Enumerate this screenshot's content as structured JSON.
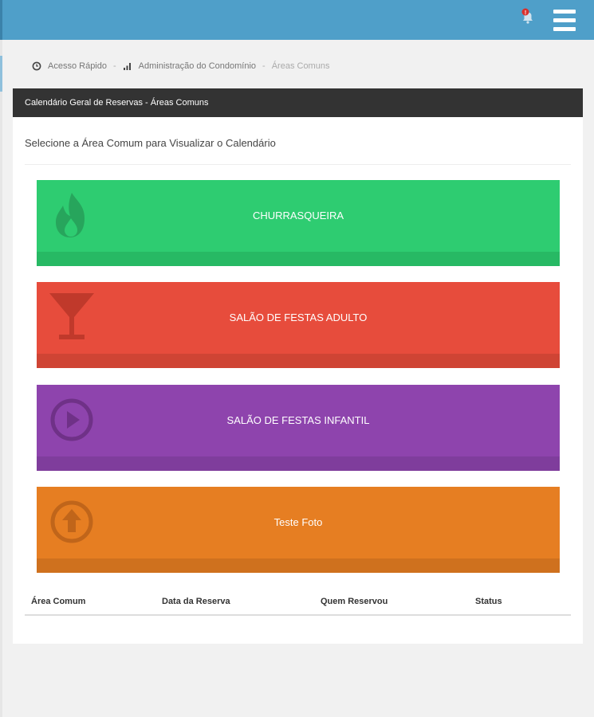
{
  "header": {
    "notification_badge": "!",
    "colors": {
      "bar": "#4f9fc9"
    },
    "icons": [
      "bell-icon",
      "hamburger-menu-icon"
    ]
  },
  "breadcrumb": {
    "items": [
      "Acesso Rápido",
      "Administração do Condomínio",
      "Áreas Comuns"
    ],
    "separator": "-",
    "icons": [
      "clock-icon",
      "signal-bars-icon"
    ]
  },
  "panel": {
    "title": "Calendário Geral de Reservas - Áreas Comuns",
    "subtitle": "Selecione a Área Comum para Visualizar o Calendário"
  },
  "areas": [
    {
      "label": "CHURRASQUEIRA",
      "icon": "fire-icon",
      "color": "#2ecc71"
    },
    {
      "label": "SALÃO DE FESTAS ADULTO",
      "icon": "cocktail-glass-icon",
      "color": "#e74c3c"
    },
    {
      "label": "SALÃO DE FESTAS INFANTIL",
      "icon": "play-circle-icon",
      "color": "#8e44ad"
    },
    {
      "label": "Teste Foto",
      "icon": "arrow-up-circle-icon",
      "color": "#e67e22"
    }
  ],
  "table": {
    "columns": [
      "Área Comum",
      "Data da Reserva",
      "Quem Reservou",
      "Status"
    ]
  }
}
